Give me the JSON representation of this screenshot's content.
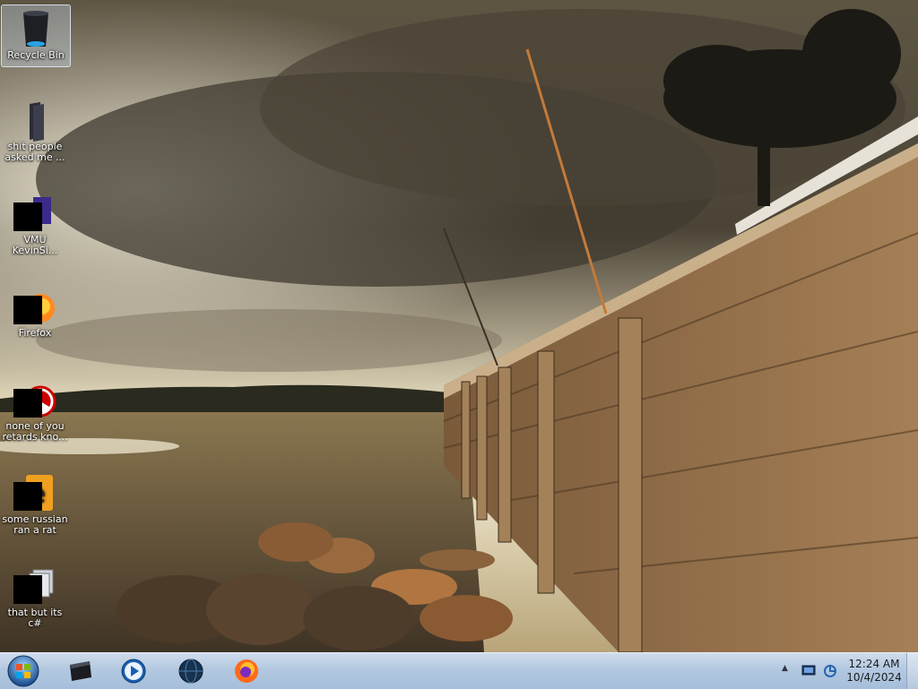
{
  "desktop": {
    "icons": [
      {
        "label": "Recycle Bin",
        "icon": "recycle-bin-icon"
      },
      {
        "label": "shit people asked me ...",
        "icon": "folder-icon"
      },
      {
        "label": "VMU KevinSi...",
        "icon": "app-icon"
      },
      {
        "label": "Firefox",
        "icon": "firefox-icon"
      },
      {
        "label": "none of you retards kno...",
        "icon": "app-icon"
      },
      {
        "label": "some russian ran a rat",
        "icon": "app-icon"
      },
      {
        "label": "that but its c#",
        "icon": "folder-icon"
      }
    ]
  },
  "taskbar": {
    "pinned": [
      "folder-icon",
      "media-player-icon",
      "globe-icon",
      "firefox-icon"
    ],
    "tray_icons": [
      "show-hidden-icons-chevron",
      "network-icon",
      "app-tray-icon"
    ],
    "time": "12:24 AM",
    "date": "10/4/2024"
  }
}
